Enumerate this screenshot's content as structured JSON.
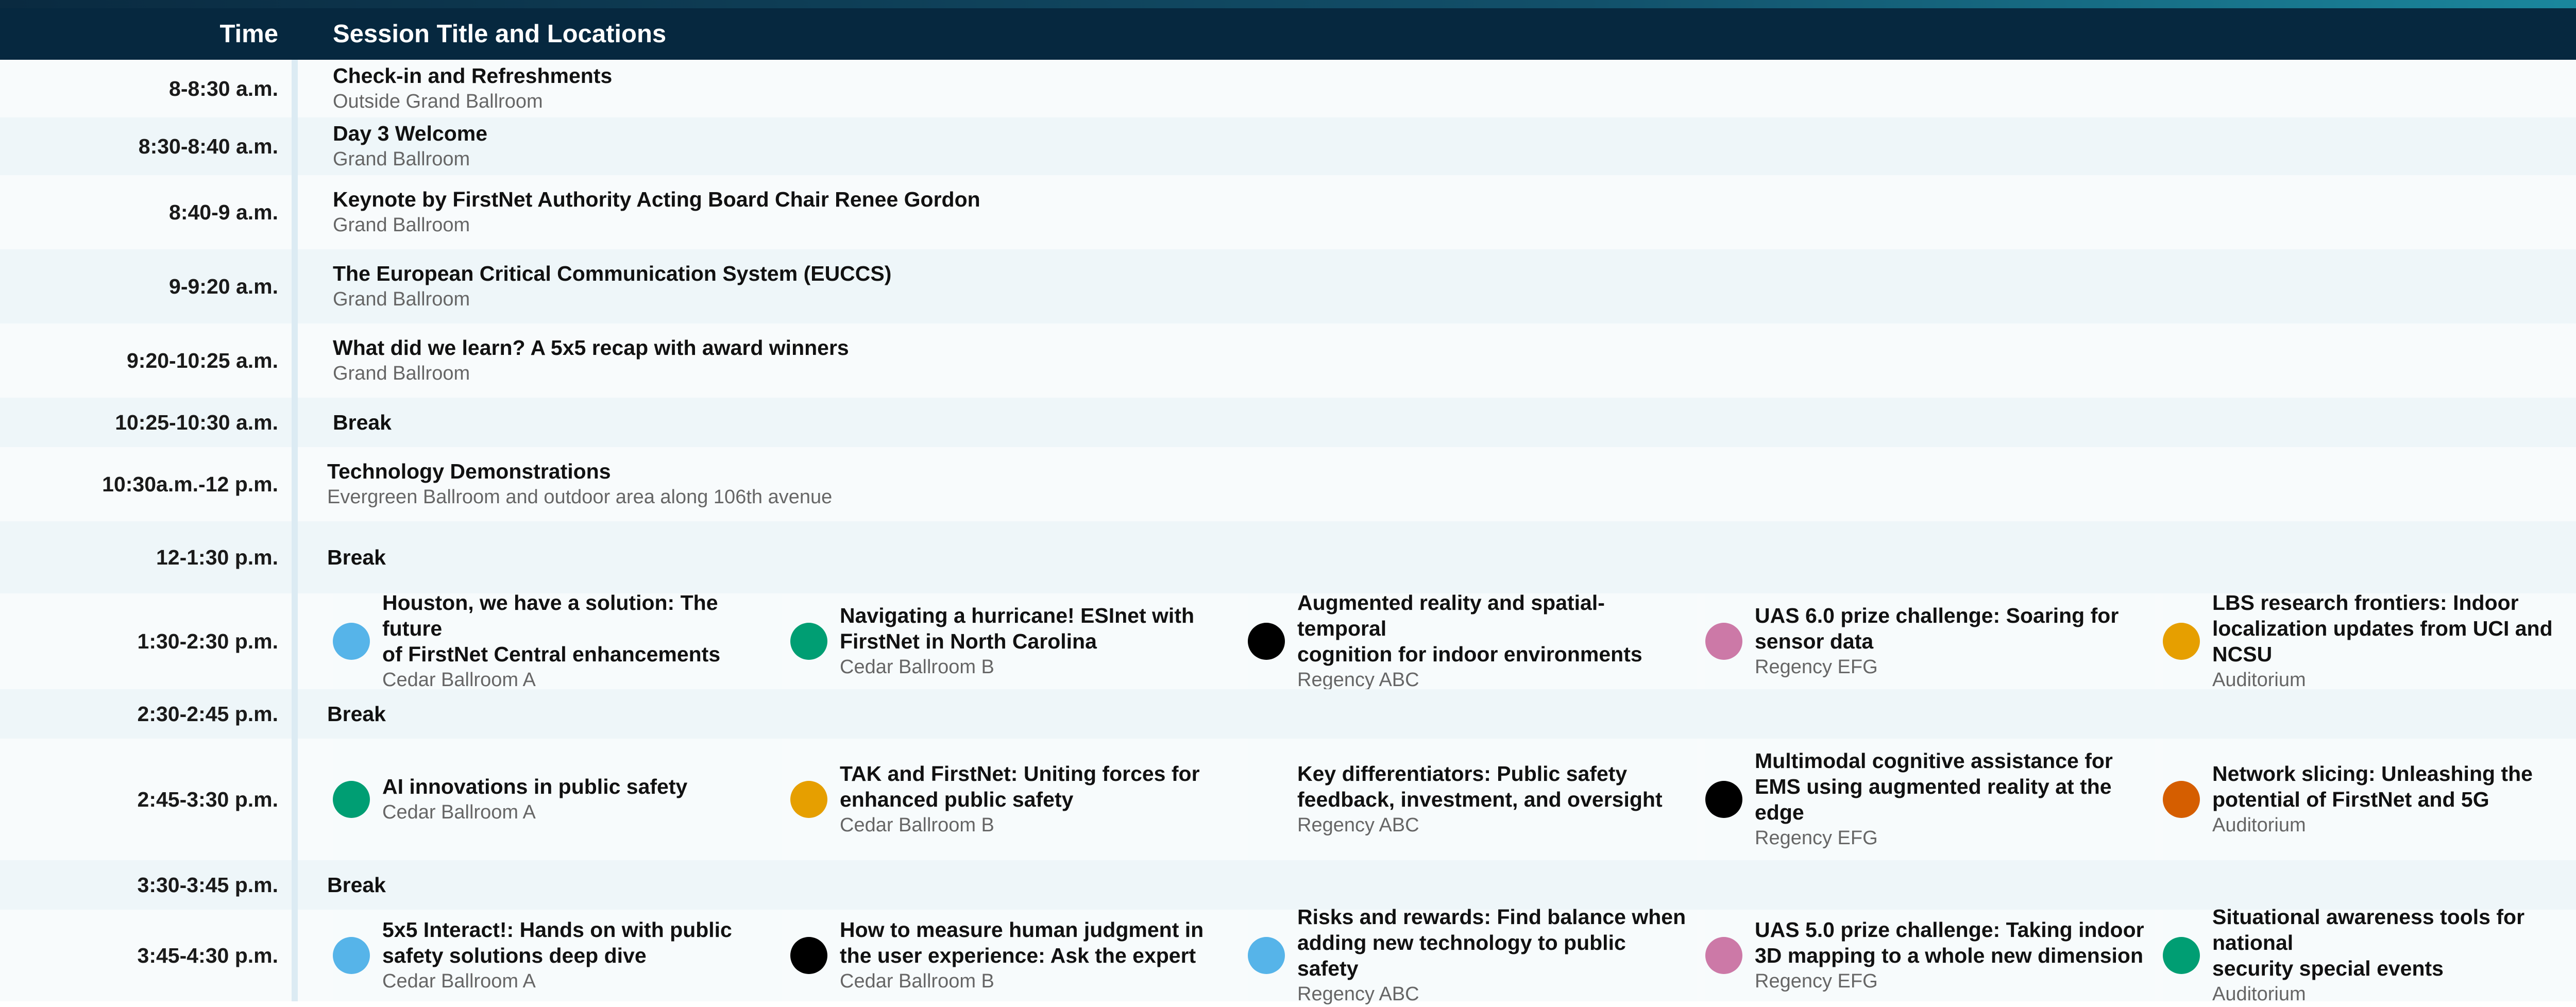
{
  "header": {
    "time_label": "Time",
    "session_label": "Session Title and Locations"
  },
  "colors": {
    "header_bg": "#06283f",
    "sky": "#56b4e9",
    "green": "#009e73",
    "black": "#000000",
    "pink": "#cc79a7",
    "orange": "#e69f00",
    "vermillion": "#d55e00"
  },
  "rows": [
    {
      "time": "8-8:30 a.m.",
      "title": "Check-in and Refreshments",
      "location": "Outside Grand Ballroom"
    },
    {
      "time": "8:30-8:40 a.m.",
      "title": "Day 3 Welcome",
      "location": "Grand Ballroom"
    },
    {
      "time": "8:40-9 a.m.",
      "title": "Keynote by FirstNet Authority Acting Board Chair Renee Gordon",
      "location": "Grand Ballroom"
    },
    {
      "time": "9-9:20 a.m.",
      "title": "The European Critical Communication System (EUCCS)",
      "location": "Grand Ballroom"
    },
    {
      "time": "9:20-10:25 a.m.",
      "title": "What did we learn? A 5x5 recap with award winners",
      "location": "Grand Ballroom"
    },
    {
      "time": "10:25-10:30 a.m.",
      "title": "Break"
    },
    {
      "time": "10:30a.m.-12 p.m.",
      "title": "Technology Demonstrations",
      "location": "Evergreen Ballroom and outdoor area along 106th avenue"
    },
    {
      "time": "12-1:30 p.m.",
      "title": "Break"
    }
  ],
  "track_rows": [
    {
      "time": "1:30-2:30 p.m.",
      "sessions": [
        {
          "title_lines": [
            "Houston, we have a solution: The future",
            "of FirstNet Central enhancements"
          ],
          "location": "Cedar Ballroom A",
          "dot": "sky"
        },
        {
          "title_lines": [
            "Navigating a hurricane! ESInet with",
            "FirstNet in North Carolina"
          ],
          "location": "Cedar Ballroom B",
          "dot": "green"
        },
        {
          "title_lines": [
            "Augmented reality and spatial-temporal",
            "cognition for indoor environments"
          ],
          "location": "Regency ABC",
          "dot": "black"
        },
        {
          "title_lines": [
            "UAS 6.0 prize challenge: Soaring for",
            "sensor data"
          ],
          "location": "Regency EFG",
          "dot": "pink"
        },
        {
          "title_lines": [
            "LBS research frontiers: Indoor",
            "localization updates from UCI and NCSU"
          ],
          "location": "Auditorium",
          "dot": "orange"
        }
      ]
    },
    {
      "time": "2:30-2:45 p.m.",
      "break": "Break"
    },
    {
      "time": "2:45-3:30 p.m.",
      "sessions": [
        {
          "title_lines": [
            "AI innovations in public safety"
          ],
          "location": "Cedar Ballroom A",
          "dot": "green"
        },
        {
          "title_lines": [
            "TAK and FirstNet: Uniting forces for",
            "enhanced public safety"
          ],
          "location": "Cedar Ballroom B",
          "dot": "orange"
        },
        {
          "title_lines": [
            "Key differentiators: Public safety",
            "feedback, investment, and oversight"
          ],
          "location": "Regency ABC",
          "dot": ""
        },
        {
          "title_lines": [
            "Multimodal cognitive assistance for",
            "EMS using augmented reality at the",
            "edge"
          ],
          "location": "Regency EFG",
          "dot": "black"
        },
        {
          "title_lines": [
            "Network slicing: Unleashing the",
            "potential of FirstNet and 5G"
          ],
          "location": "Auditorium",
          "dot": "vermillion"
        }
      ]
    },
    {
      "time": "3:30-3:45 p.m.",
      "break": "Break"
    },
    {
      "time": "3:45-4:30 p.m.",
      "sessions": [
        {
          "title_lines": [
            "5x5 Interact!: Hands on with public",
            "safety solutions deep dive"
          ],
          "location": "Cedar Ballroom A",
          "dot": "sky"
        },
        {
          "title_lines": [
            "How to measure human judgment in",
            "the user experience: Ask the expert"
          ],
          "location": "Cedar Ballroom B",
          "dot": "black"
        },
        {
          "title_lines": [
            "Risks and rewards: Find balance when",
            "adding new technology to public safety"
          ],
          "location": "Regency ABC",
          "dot": "sky"
        },
        {
          "title_lines": [
            "UAS 5.0 prize challenge: Taking indoor",
            "3D mapping to a whole new dimension"
          ],
          "location": "Regency EFG",
          "dot": "pink"
        },
        {
          "title_lines": [
            "Situational awareness tools for national",
            "security special events"
          ],
          "location": "Auditorium",
          "dot": "green"
        }
      ]
    }
  ]
}
